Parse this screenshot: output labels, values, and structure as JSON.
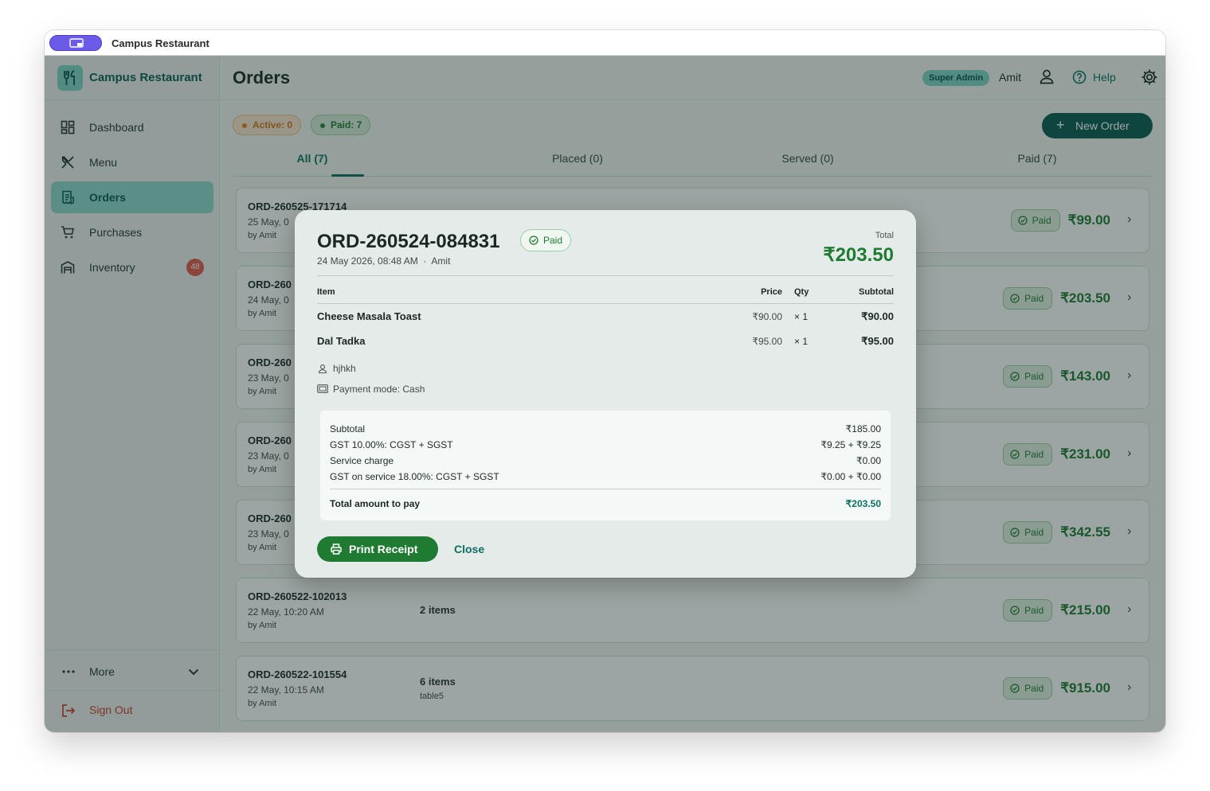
{
  "window": {
    "title": "Campus Restaurant"
  },
  "sidebar": {
    "brand": "Campus Restaurant",
    "items": [
      {
        "label": "Dashboard",
        "icon": "dashboard-icon"
      },
      {
        "label": "Menu",
        "icon": "utensils-icon"
      },
      {
        "label": "Orders",
        "icon": "receipt-icon",
        "active": true
      },
      {
        "label": "Purchases",
        "icon": "cart-icon"
      },
      {
        "label": "Inventory",
        "icon": "warehouse-icon",
        "badge": "48"
      }
    ],
    "more_label": "More",
    "signout_label": "Sign Out"
  },
  "header": {
    "title": "Orders",
    "role_badge": "Super Admin",
    "user_name": "Amit",
    "help_label": "Help"
  },
  "status": {
    "active": "Active: 0",
    "paid": "Paid: 7"
  },
  "new_order_label": "New Order",
  "tabs": [
    {
      "label": "All (7)",
      "active": true
    },
    {
      "label": "Placed (0)"
    },
    {
      "label": "Served (0)"
    },
    {
      "label": "Paid (7)"
    }
  ],
  "orders": [
    {
      "id": "ORD-260525-171714",
      "date": "25 May, 0",
      "by": "by Amit",
      "items": "",
      "note": "",
      "status": "Paid",
      "amount": "₹99.00"
    },
    {
      "id": "ORD-260",
      "date": "24 May, 0",
      "by": "by Amit",
      "items": "",
      "note": "",
      "status": "Paid",
      "amount": "₹203.50"
    },
    {
      "id": "ORD-260",
      "date": "23 May, 0",
      "by": "by Amit",
      "items": "",
      "note": "",
      "status": "Paid",
      "amount": "₹143.00"
    },
    {
      "id": "ORD-260",
      "date": "23 May, 0",
      "by": "by Amit",
      "items": "",
      "note": "",
      "status": "Paid",
      "amount": "₹231.00"
    },
    {
      "id": "ORD-260",
      "date": "23 May, 0",
      "by": "by Amit",
      "items": "",
      "note": "",
      "status": "Paid",
      "amount": "₹342.55"
    },
    {
      "id": "ORD-260522-102013",
      "date": "22 May, 10:20 AM",
      "by": "by Amit",
      "items": "2 items",
      "note": "",
      "status": "Paid",
      "amount": "₹215.00"
    },
    {
      "id": "ORD-260522-101554",
      "date": "22 May, 10:15 AM",
      "by": "by Amit",
      "items": "6 items",
      "note": "table5",
      "status": "Paid",
      "amount": "₹915.00"
    }
  ],
  "modal": {
    "order_id": "ORD-260524-084831",
    "status": "Paid",
    "meta": "24 May 2026, 08:48 AM  ·  Amit",
    "total_label": "Total",
    "total": "₹203.50",
    "columns": {
      "item": "Item",
      "price": "Price",
      "qty": "Qty",
      "subtotal": "Subtotal"
    },
    "items": [
      {
        "name": "Cheese Masala Toast",
        "price": "₹90.00",
        "qty": "× 1",
        "subtotal": "₹90.00"
      },
      {
        "name": "Dal Tadka",
        "price": "₹95.00",
        "qty": "× 1",
        "subtotal": "₹95.00"
      }
    ],
    "customer": "hjhkh",
    "payment_mode": "Payment mode: Cash",
    "summary": [
      {
        "label": "Subtotal",
        "value": "₹185.00"
      },
      {
        "label": "GST 10.00%: CGST + SGST",
        "value": "₹9.25 + ₹9.25"
      },
      {
        "label": "Service charge",
        "value": "₹0.00"
      },
      {
        "label": "GST on service 18.00%: CGST + SGST",
        "value": "₹0.00 + ₹0.00"
      }
    ],
    "total_to_pay_label": "Total amount to pay",
    "total_to_pay": "₹203.50",
    "print_label": "Print Receipt",
    "close_label": "Close"
  },
  "colors": {
    "brand": "#0d6e62",
    "paid_green": "#1f7a32",
    "active_orange": "#e37b1b",
    "badge_red": "#e25a4a"
  }
}
